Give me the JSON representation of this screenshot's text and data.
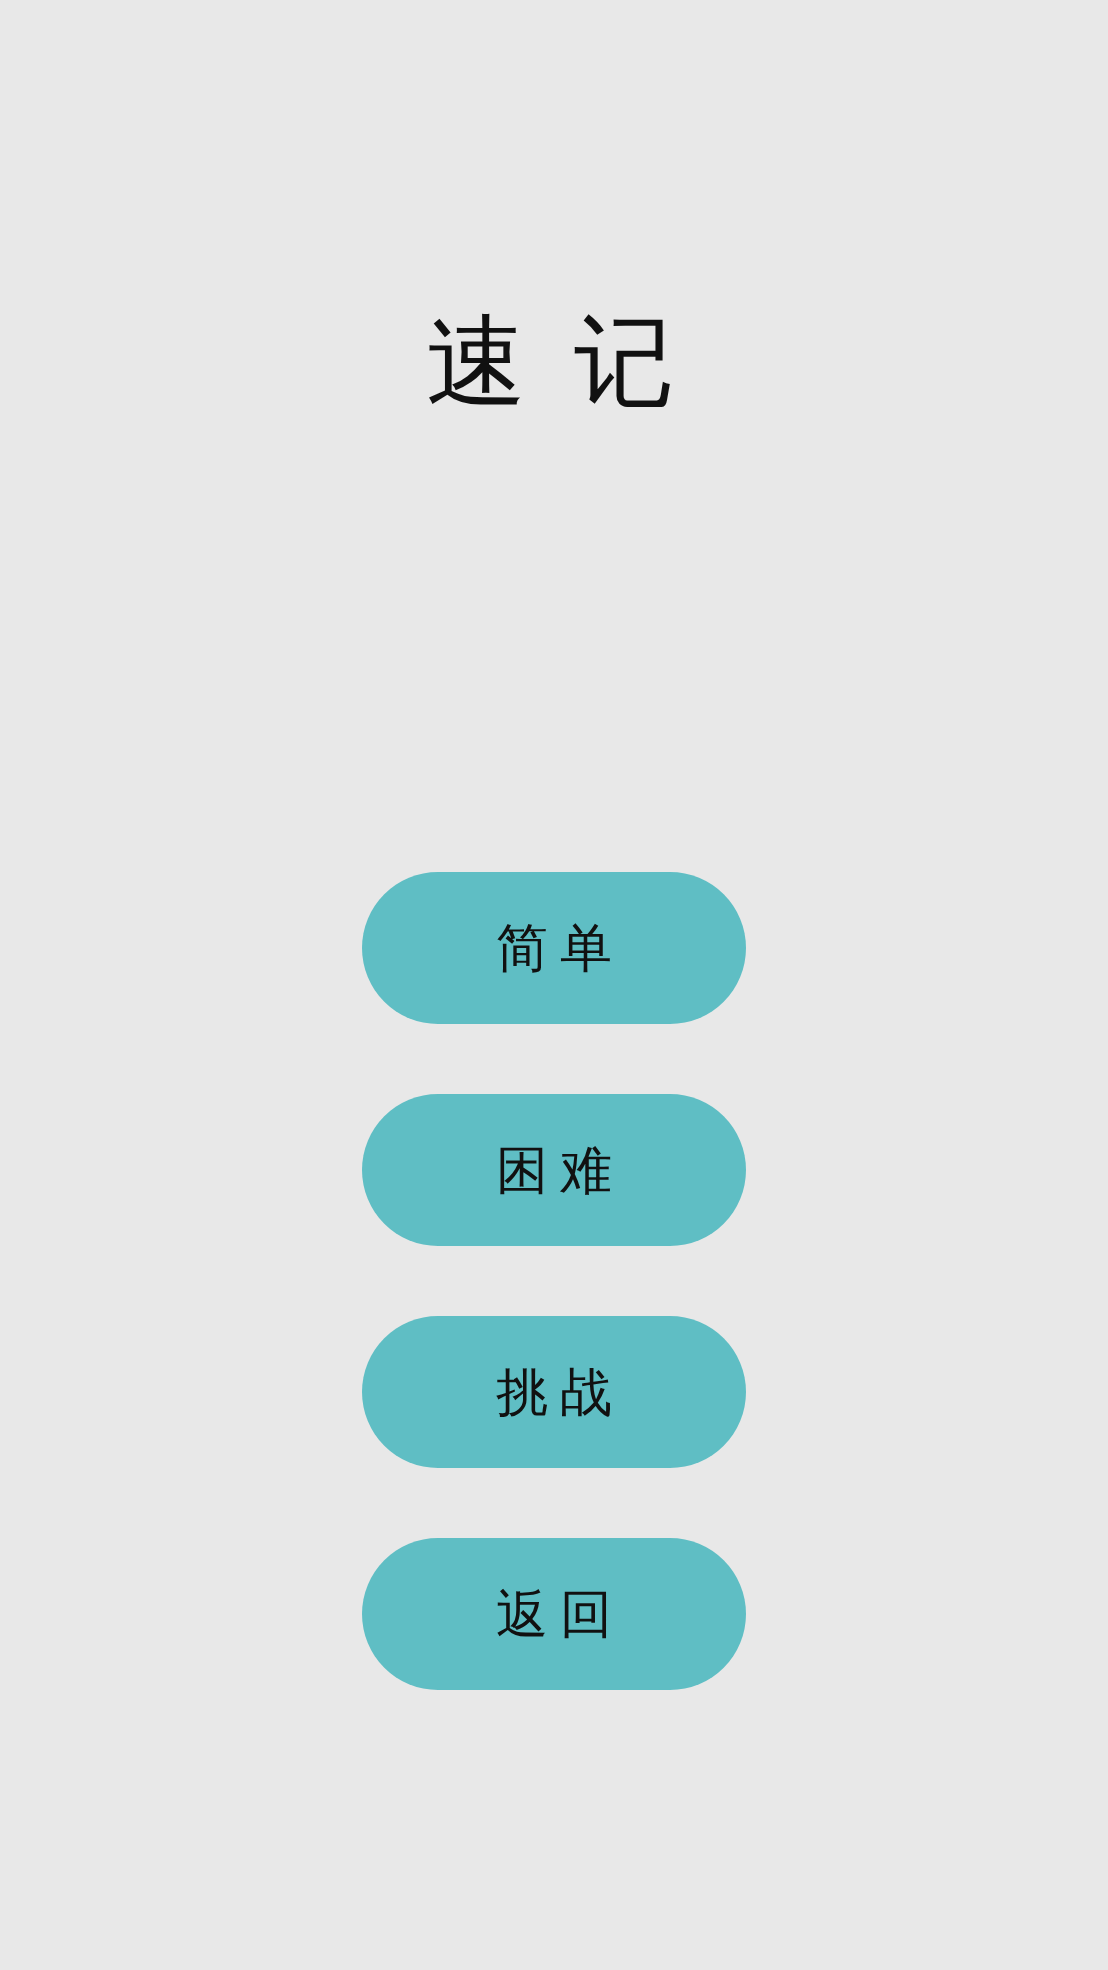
{
  "title": "速 记",
  "buttons": [
    {
      "label": "简单"
    },
    {
      "label": "困难"
    },
    {
      "label": "挑战"
    },
    {
      "label": "返回"
    }
  ]
}
